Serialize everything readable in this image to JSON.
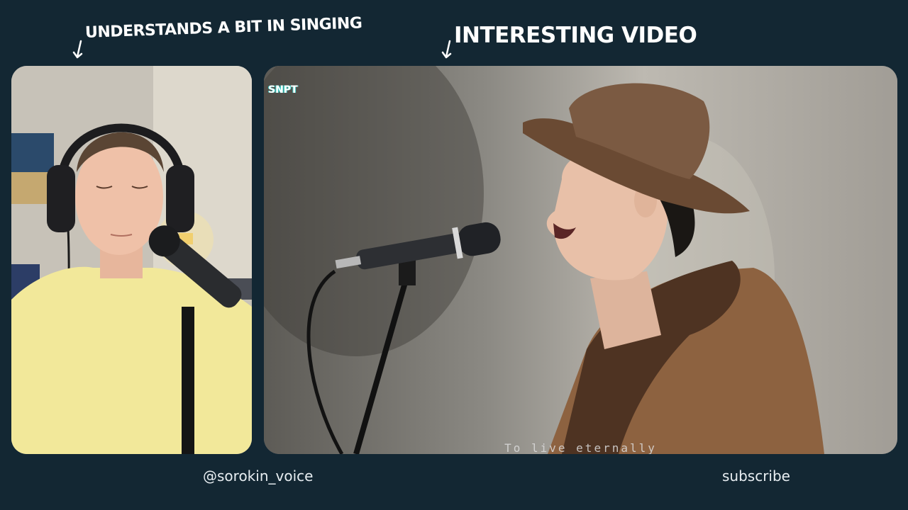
{
  "captions": {
    "left": "UNDERSTANDS A BIT IN SINGING",
    "right": "INTERESTING VIDEO"
  },
  "video": {
    "watermark": "SNPT",
    "subtitle": "To live eternally"
  },
  "footer": {
    "handle": "@sorokin_voice",
    "subscribe": "subscribe"
  },
  "colors": {
    "background": "#132733",
    "text": "#ffffff"
  }
}
